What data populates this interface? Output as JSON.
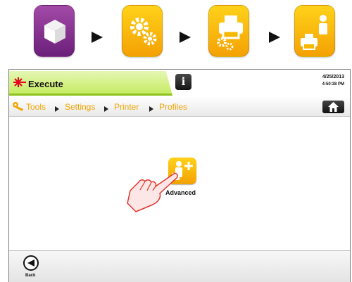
{
  "sequence": {
    "icons": [
      "cube-icon",
      "gears-icon",
      "printer-gears-icon",
      "printer-user-icon"
    ],
    "colors": {
      "purple": "#7d2a8a",
      "yellow": "#f7b800"
    }
  },
  "status": {
    "mode_label": "Execute",
    "mode_icon": "laser-burst-icon",
    "info_label": "i",
    "date": "4/25/2013",
    "time": "4:50:38 PM",
    "accent": "#c6eb62"
  },
  "breadcrumb": {
    "key_icon": "key-icon",
    "items": [
      "Tools",
      "Settings",
      "Printer",
      "Profiles"
    ],
    "home_icon": "home-icon",
    "color": "#f0a500"
  },
  "content": {
    "advanced_label": "Advanced",
    "advanced_icon": "printer-user-add-icon",
    "pointer_icon": "pointing-hand-icon"
  },
  "footer": {
    "back_label": "Back",
    "back_icon": "back-arrow-icon"
  }
}
